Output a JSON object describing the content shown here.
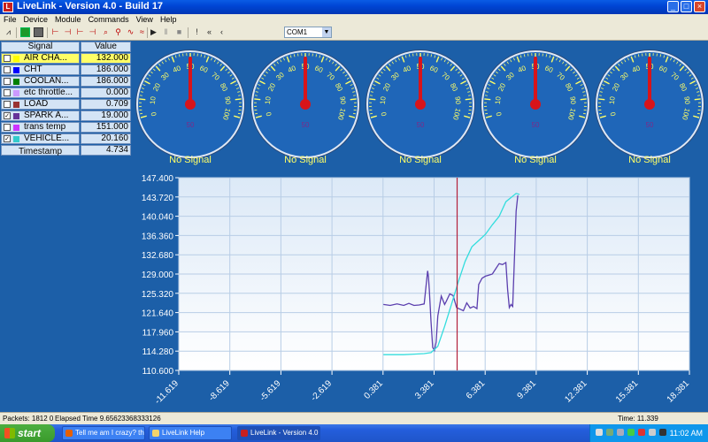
{
  "window": {
    "title": "LiveLink - Version 4.0 - Build 17",
    "icon": "livelink-app-icon",
    "controls": {
      "minimize": "_",
      "maximize": "□",
      "close": "×"
    }
  },
  "menu": [
    "File",
    "Device",
    "Module",
    "Commands",
    "View",
    "Help"
  ],
  "toolbar": {
    "icons": [
      "chart-icon",
      "green-square-icon",
      "gray-square-icon",
      "marker-bracket-icon",
      "marker-bracket-icon",
      "marker-bracket-icon",
      "marker-bracket-icon",
      "probe-icon",
      "probe-icon",
      "wave-icon",
      "wave-icon",
      "play-icon",
      "pause-icon",
      "stop-icon",
      "alert-icon",
      "rewind-icon",
      "back-icon"
    ],
    "port": "COM1"
  },
  "signal_table": {
    "header": {
      "signal": "Signal",
      "value": "Value"
    },
    "rows": [
      {
        "label": "AIR CHA...",
        "value": "132.000",
        "color": "#ffff00",
        "checked": false,
        "highlight": true
      },
      {
        "label": "CHT",
        "value": "186.000",
        "color": "#0000ff",
        "checked": false,
        "highlight": false
      },
      {
        "label": "COOLAN...",
        "value": "186.000",
        "color": "#008000",
        "checked": false,
        "highlight": false
      },
      {
        "label": "etc throttle...",
        "value": "0.000",
        "color": "#cc99ff",
        "checked": false,
        "highlight": false
      },
      {
        "label": "LOAD",
        "value": "0.709",
        "color": "#993333",
        "checked": false,
        "highlight": false
      },
      {
        "label": "SPARK A...",
        "value": "19.000",
        "color": "#663399",
        "checked": true,
        "highlight": false
      },
      {
        "label": "trans temp",
        "value": "151.000",
        "color": "#cc33ff",
        "checked": false,
        "highlight": false
      },
      {
        "label": "VEHICLE...",
        "value": "20.160",
        "color": "#33cccc",
        "checked": true,
        "highlight": false
      }
    ],
    "timestamp": {
      "label": "Timestamp",
      "value": "4.734"
    }
  },
  "gauges": [
    {
      "status": "No Signal",
      "ticks": [
        "0",
        "10",
        "20",
        "30",
        "40",
        "50",
        "60",
        "70",
        "80",
        "90",
        "100"
      ],
      "center_label": "50"
    },
    {
      "status": "No Signal",
      "ticks": [
        "0",
        "10",
        "20",
        "30",
        "40",
        "50",
        "60",
        "70",
        "80",
        "90",
        "100"
      ],
      "center_label": "50"
    },
    {
      "status": "No Signal",
      "ticks": [
        "0",
        "10",
        "20",
        "30",
        "40",
        "50",
        "60",
        "70",
        "80",
        "90",
        "100"
      ],
      "center_label": "50"
    },
    {
      "status": "No Signal",
      "ticks": [
        "0",
        "10",
        "20",
        "30",
        "40",
        "50",
        "60",
        "70",
        "80",
        "90",
        "100"
      ],
      "center_label": "50"
    },
    {
      "status": "No Signal",
      "ticks": [
        "0",
        "10",
        "20",
        "30",
        "40",
        "50",
        "60",
        "70",
        "80",
        "90",
        "100"
      ],
      "center_label": "50"
    }
  ],
  "chart_data": {
    "type": "line",
    "title": "",
    "xlabel": "",
    "ylabel": "",
    "xlim": [
      -11.619,
      18.381
    ],
    "ylim": [
      110.6,
      147.4
    ],
    "x_ticks": [
      "-11.619",
      "-8.619",
      "-5.619",
      "-2.619",
      "0.381",
      "3.381",
      "6.381",
      "9.381",
      "12.381",
      "15.381",
      "18.381"
    ],
    "y_ticks": [
      "147.400",
      "143.720",
      "140.040",
      "136.360",
      "132.680",
      "129.000",
      "125.320",
      "121.640",
      "117.960",
      "114.280",
      "110.600"
    ],
    "grid": true,
    "cursor_x": 4.734,
    "series": [
      {
        "color": "#5b3fae",
        "x": [
          0.4,
          0.8,
          1.2,
          1.6,
          1.9,
          2.2,
          2.5,
          2.8,
          3.0,
          3.05,
          3.1,
          3.2,
          3.3,
          3.4,
          3.5,
          3.6,
          3.8,
          4.0,
          4.1,
          4.3,
          4.5,
          4.7,
          4.9,
          5.1,
          5.3,
          5.5,
          5.7,
          5.9,
          6.0,
          6.2,
          6.4,
          6.6,
          6.8,
          7.0,
          7.2,
          7.4,
          7.6,
          7.7,
          7.8,
          7.9,
          8.0,
          8.1,
          8.2,
          8.3
        ],
        "values": [
          123.2,
          123.0,
          123.3,
          123.0,
          123.4,
          123.0,
          123.1,
          123.3,
          129.6,
          128.5,
          126.0,
          120.0,
          115.0,
          114.4,
          116.0,
          121.0,
          124.8,
          123.2,
          123.8,
          125.2,
          124.9,
          122.6,
          122.3,
          122.0,
          123.5,
          122.5,
          122.8,
          122.4,
          127.0,
          128.2,
          128.6,
          128.8,
          129.0,
          130.0,
          131.0,
          130.8,
          131.2,
          126.0,
          122.6,
          123.2,
          122.8,
          132.0,
          141.0,
          144.0
        ]
      },
      {
        "color": "#33dddd",
        "x": [
          0.4,
          1.0,
          1.6,
          2.2,
          2.8,
          3.2,
          3.6,
          4.0,
          4.4,
          4.8,
          5.2,
          5.6,
          6.0,
          6.4,
          6.8,
          7.2,
          7.6,
          7.9,
          8.2,
          8.4
        ],
        "values": [
          113.6,
          113.6,
          113.6,
          113.7,
          113.8,
          114.0,
          115.2,
          119.0,
          123.2,
          127.5,
          131.4,
          134.2,
          135.4,
          136.6,
          138.4,
          140.0,
          142.8,
          143.6,
          144.4,
          144.2
        ]
      }
    ]
  },
  "statusbar": {
    "packets": "Packets: 1812 0",
    "elapsed": "Elapsed Time 9.65623368333126",
    "time": "Time: 11.339"
  },
  "taskbar": {
    "start": "start",
    "tasks": [
      {
        "label": "Tell me am I crazy? th...",
        "icon": "firefox-icon",
        "active": false
      },
      {
        "label": "LiveLink Help",
        "icon": "help-doc-icon",
        "active": false
      },
      {
        "label": "LiveLink - Version 4.0 ...",
        "icon": "livelink-app-icon",
        "active": true
      }
    ],
    "clock": "11:02 AM"
  }
}
